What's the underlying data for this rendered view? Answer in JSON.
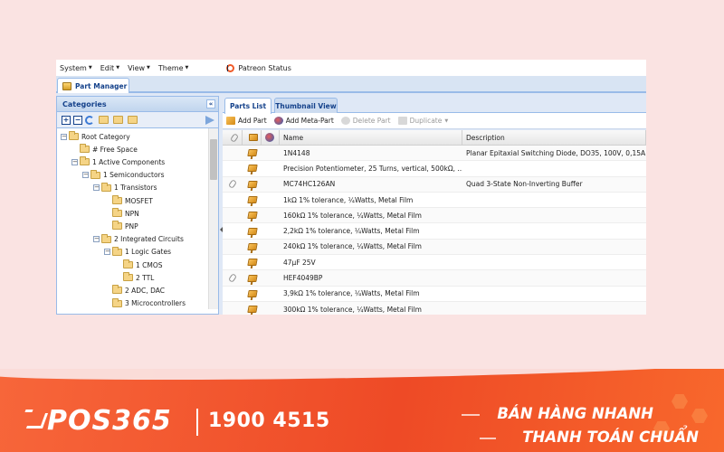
{
  "menu": {
    "items": [
      {
        "label": "System"
      },
      {
        "label": "Edit"
      },
      {
        "label": "View"
      },
      {
        "label": "Theme"
      }
    ],
    "patreon_label": "Patreon Status"
  },
  "main_tab": {
    "label": "Part Manager"
  },
  "categories": {
    "title": "Categories",
    "collapse": "«",
    "nodes": [
      {
        "label": "Root Category",
        "depth": 0,
        "expand": "−"
      },
      {
        "label": "# Free Space",
        "depth": 1,
        "expand": ""
      },
      {
        "label": "1 Active Components",
        "depth": 1,
        "expand": "−"
      },
      {
        "label": "1 Semiconductors",
        "depth": 2,
        "expand": "−"
      },
      {
        "label": "1 Transistors",
        "depth": 3,
        "expand": "−"
      },
      {
        "label": "MOSFET",
        "depth": 4,
        "expand": ""
      },
      {
        "label": "NPN",
        "depth": 4,
        "expand": ""
      },
      {
        "label": "PNP",
        "depth": 4,
        "expand": ""
      },
      {
        "label": "2 Integrated Circuits",
        "depth": 3,
        "expand": "−"
      },
      {
        "label": "1 Logic Gates",
        "depth": 4,
        "expand": "−"
      },
      {
        "label": "1 CMOS",
        "depth": 5,
        "expand": ""
      },
      {
        "label": "2 TTL",
        "depth": 5,
        "expand": ""
      },
      {
        "label": "2 ADC, DAC",
        "depth": 4,
        "expand": ""
      },
      {
        "label": "3 Microcontrollers",
        "depth": 4,
        "expand": ""
      }
    ]
  },
  "parts": {
    "tabs": [
      {
        "label": "Parts List"
      },
      {
        "label": "Thumbnail View"
      }
    ],
    "toolbar": {
      "add_part": "Add Part",
      "add_meta_part": "Add Meta-Part",
      "delete_part": "Delete Part",
      "duplicate": "Duplicate"
    },
    "columns": {
      "name": "Name",
      "description": "Description"
    },
    "rows": [
      {
        "attach": false,
        "name": "1N4148",
        "description": "Planar Epitaxial Switching Diode, DO35, 100V, 0,15A"
      },
      {
        "attach": false,
        "name": "Precision Potentiometer, 25 Turns, vertical, 500kΩ, ...",
        "description": ""
      },
      {
        "attach": true,
        "name": "MC74HC126AN",
        "description": "Quad 3-State Non-Inverting Buffer"
      },
      {
        "attach": false,
        "name": "1kΩ 1% tolerance, ¼Watts, Metal Film",
        "description": ""
      },
      {
        "attach": false,
        "name": "160kΩ 1% tolerance, ¼Watts, Metal Film",
        "description": ""
      },
      {
        "attach": false,
        "name": "2,2kΩ 1% tolerance, ¼Watts, Metal Film",
        "description": ""
      },
      {
        "attach": false,
        "name": "240kΩ 1% tolerance, ¼Watts, Metal Film",
        "description": ""
      },
      {
        "attach": false,
        "name": "47µF 25V",
        "description": ""
      },
      {
        "attach": true,
        "name": "HEF4049BP",
        "description": ""
      },
      {
        "attach": false,
        "name": "3,9kΩ 1% tolerance, ¼Watts, Metal Film",
        "description": ""
      },
      {
        "attach": false,
        "name": "300kΩ 1% tolerance, ¼Watts, Metal Film",
        "description": ""
      }
    ]
  },
  "banner": {
    "logo": "POS365",
    "phone": "1900 4515",
    "slogan_line1": "BÁN HÀNG NHANH",
    "slogan_line2": "THANH TOÁN CHUẨN"
  }
}
